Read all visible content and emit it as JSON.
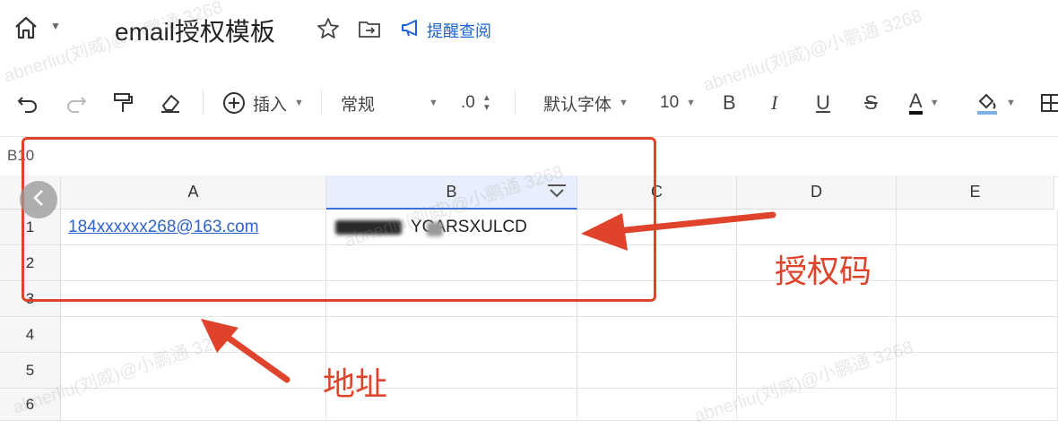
{
  "header": {
    "title": "email授权模板",
    "remind_label": "提醒查阅"
  },
  "toolbar": {
    "insert_label": "插入",
    "format_label": "常规",
    "decimal_label": ".0",
    "font_label": "默认字体",
    "font_size": "10",
    "bold_label": "B",
    "italic_label": "I",
    "underline_label": "U",
    "strike_label": "S",
    "font_color_label": "A"
  },
  "formula_bar": {
    "cell_ref": "B10"
  },
  "sheet": {
    "columns": [
      "A",
      "B",
      "C",
      "D",
      "E"
    ],
    "rows": [
      "1",
      "2",
      "3",
      "4",
      "5",
      "6"
    ],
    "cells": {
      "A1": "184xxxxxx268@163.com",
      "B1": "YCARSXULCD"
    }
  },
  "annotations": {
    "auth_code": "授权码",
    "address": "地址"
  },
  "watermark": "abnerliu(刘威)@小鹏通 3268",
  "colors": {
    "accent": "#1e63d6",
    "annotation_red": "#e0432b",
    "link": "#2f63cf"
  }
}
